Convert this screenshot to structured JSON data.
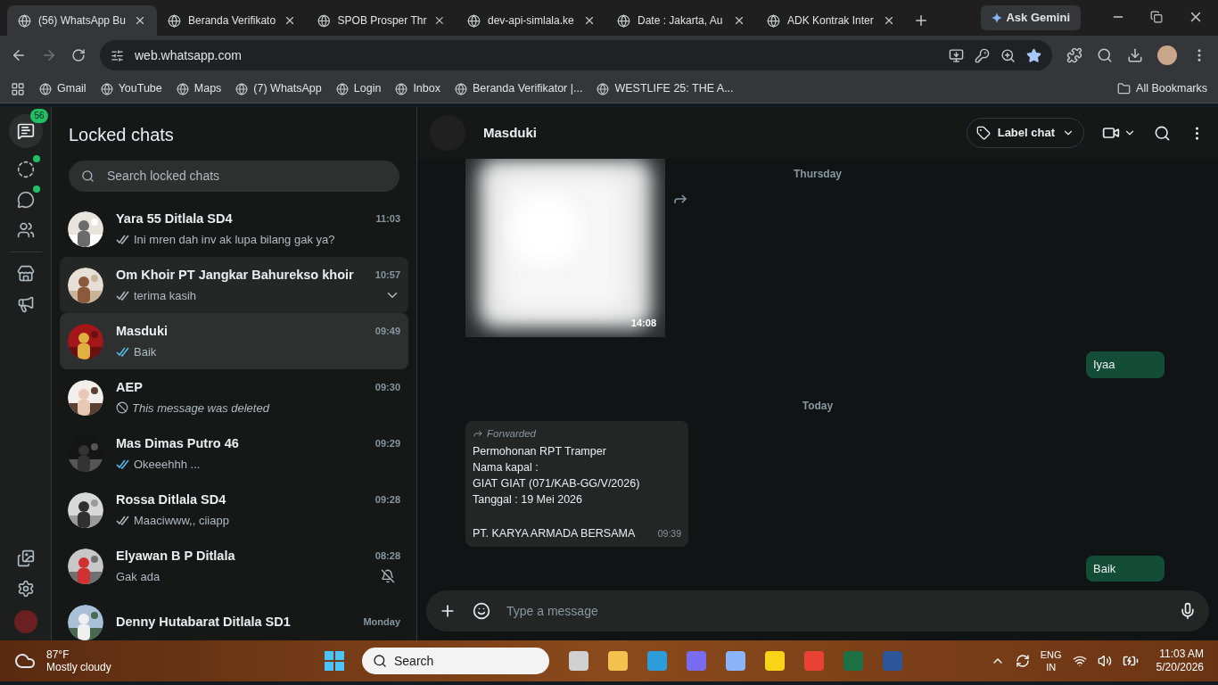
{
  "browser": {
    "tabs": [
      {
        "title": "(56) WhatsApp Bu",
        "selected": true
      },
      {
        "title": "Beranda Verifikato",
        "selected": false
      },
      {
        "title": "SPOB Prosper Thr",
        "selected": false
      },
      {
        "title": "dev-api-simlala.ke",
        "selected": false
      },
      {
        "title": "Date : Jakarta, Au",
        "selected": false
      },
      {
        "title": "ADK Kontrak Inter",
        "selected": false
      }
    ],
    "ask_gemini": "Ask Gemini",
    "url": "web.whatsapp.com",
    "bookmarks": [
      {
        "label": "Gmail"
      },
      {
        "label": "YouTube"
      },
      {
        "label": "Maps"
      },
      {
        "label": "(7) WhatsApp"
      },
      {
        "label": "Login"
      },
      {
        "label": "Inbox"
      },
      {
        "label": "Beranda Verifikator |..."
      },
      {
        "label": "WESTLIFE 25: THE A..."
      }
    ],
    "all_bookmarks": "All Bookmarks"
  },
  "nav": {
    "unread_badge": "56",
    "status_dot": true,
    "channels_dot": true
  },
  "sidebar": {
    "title": "Locked chats",
    "search": {
      "placeholder": "Search locked chats"
    },
    "chats": [
      {
        "name": "Yara 55 Ditlala SD4",
        "time": "11:03",
        "preview": "Ini mren dah inv ak lupa bilang gak ya?",
        "kind": "delivered",
        "selected": false,
        "hovered": false,
        "muted": false
      },
      {
        "name": "Om Khoir PT Jangkar Bahurekso khoir",
        "time": "10:57",
        "preview": "terima kasih",
        "kind": "delivered",
        "selected": false,
        "hovered": true,
        "muted": false
      },
      {
        "name": "Masduki",
        "time": "09:49",
        "preview": "Baik",
        "kind": "read",
        "selected": true,
        "hovered": false,
        "muted": false
      },
      {
        "name": "AEP",
        "time": "09:30",
        "preview": "This message was deleted",
        "kind": "deleted",
        "selected": false,
        "hovered": false,
        "muted": false
      },
      {
        "name": "Mas Dimas Putro 46",
        "time": "09:29",
        "preview": "Okeeehhh ...",
        "kind": "read",
        "selected": false,
        "hovered": false,
        "muted": false
      },
      {
        "name": "Rossa Ditlala SD4",
        "time": "09:28",
        "preview": "Maaciwww,, ciiapp",
        "kind": "delivered",
        "selected": false,
        "hovered": false,
        "muted": false
      },
      {
        "name": "Elyawan B P Ditlala",
        "time": "08:28",
        "preview": "Gak ada",
        "kind": "plain",
        "selected": false,
        "hovered": false,
        "muted": true
      },
      {
        "name": "Denny Hutabarat Ditlala SD1",
        "time": "Monday",
        "selected": false,
        "hovered": false
      }
    ]
  },
  "chat": {
    "name": "Masduki",
    "label_chat": "Label chat",
    "messages": [
      {
        "time": "14:08"
      },
      {
        "kind": "date",
        "text": "Thursday"
      },
      {
        "kind": "text",
        "text": "Iyaa"
      },
      {
        "kind": "date",
        "text": "Today"
      },
      {
        "kind": "forwarded",
        "label": "Forwarded",
        "paragraphs": [
          "Permohonan RPT Tramper\nNama kapal :\nGIAT GIAT (071/KAB-GG/V/2026)\nTanggal : 19 Mei 2026",
          "PT. KARYA ARMADA BERSAMA"
        ],
        "time": "09:39"
      },
      {
        "kind": "text",
        "text": "Baik"
      }
    ],
    "composer": {
      "placeholder": "Type a message"
    }
  },
  "taskbar": {
    "temperature": "87°F",
    "weather": "Mostly cloudy",
    "search": "Search",
    "lang": "ENG",
    "region": "IN",
    "time": "11:03 AM",
    "date": "5/20/2026"
  }
}
